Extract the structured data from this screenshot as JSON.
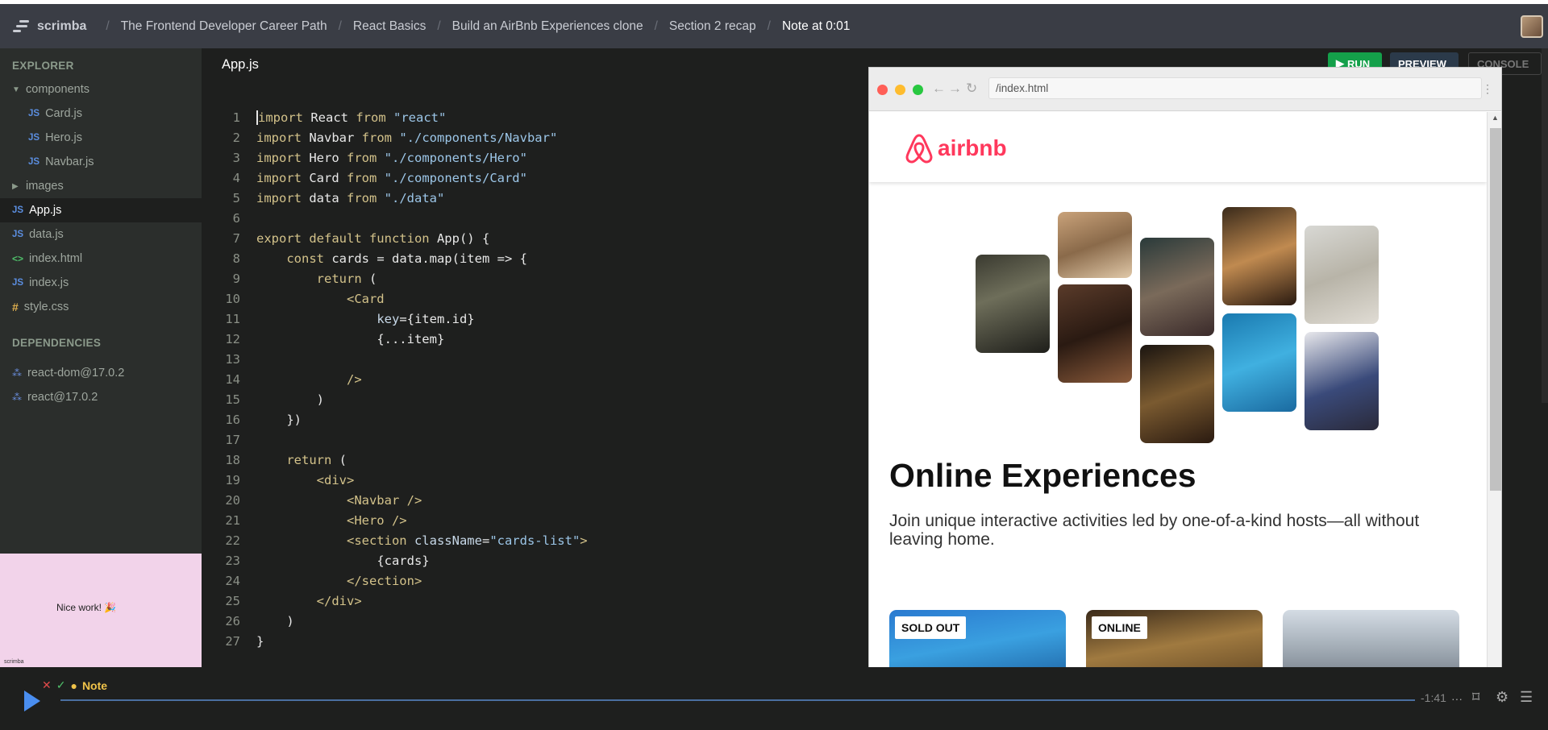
{
  "topbar": {
    "logo_text": "scrimba",
    "breadcrumbs": [
      "The Frontend Developer Career Path",
      "React Basics",
      "Build an AirBnb Experiences clone",
      "Section 2 recap",
      "Note at 0:01"
    ]
  },
  "sidebar": {
    "explorer_heading": "EXPLORER",
    "folder_components": "components",
    "card_js": "Card.js",
    "hero_js": "Hero.js",
    "navbar_js": "Navbar.js",
    "folder_images": "images",
    "app_js": "App.js",
    "data_js": "data.js",
    "index_html": "index.html",
    "index_js": "index.js",
    "style_css": "style.css",
    "dependencies_heading": "DEPENDENCIES",
    "dep_react_dom": "react-dom@17.0.2",
    "dep_react": "react@17.0.2",
    "icon_js": "JS",
    "icon_html": "<>",
    "icon_css": "#"
  },
  "nicework": {
    "text": "Nice work! 🎉",
    "small": "scrimba"
  },
  "editor": {
    "filename": "App.js",
    "lines": [
      "1",
      "2",
      "3",
      "4",
      "5",
      "6",
      "7",
      "8",
      "9",
      "10",
      "11",
      "12",
      "13",
      "14",
      "15",
      "16",
      "17",
      "18",
      "19",
      "20",
      "21",
      "22",
      "23",
      "24",
      "25",
      "26",
      "27"
    ],
    "t": {
      "import": "import",
      "from": "from",
      "react_mod": "\"react\"",
      "navbar_mod": "\"./components/Navbar\"",
      "hero_mod": "\"./components/Hero\"",
      "card_mod": "\"./components/Card\"",
      "data_mod": "\"./data\"",
      "React": " React ",
      "Navbar": " Navbar ",
      "Hero": " Hero ",
      "Card": " Card ",
      "data": " data ",
      "export_default_function": "export default function",
      "app_sig": " App() {",
      "const": "const",
      "cards_map": " cards = data.map(item => {",
      "return": "return",
      "paren_open": " (",
      "card_tag": "<Card",
      "key_attr": "key",
      "key_val": "={item.id}",
      "spread": "{...item}",
      "self_close": "/>",
      "paren_close": ")",
      "close_map": "})",
      "div_open": "<div>",
      "navbar_tag": "<Navbar />",
      "hero_tag": "<Hero />",
      "section_open": "<section",
      "classname_attr": " className",
      "eq": "=",
      "cards_list": "\"cards-list\"",
      "gt": ">",
      "cards_expr": "{cards}",
      "section_close": "</section>",
      "div_close": "</div>",
      "brace_close": "}"
    }
  },
  "buttons": {
    "run": "RUN",
    "preview": "PREVIEW",
    "console": "CONSOLE"
  },
  "browser": {
    "url": "/index.html",
    "brand": "airbnb",
    "title": "Online Experiences",
    "subtitle": "Join unique interactive activities led by one-of-a-kind hosts—all without leaving home.",
    "cards": [
      {
        "badge": "SOLD OUT"
      },
      {
        "badge": "ONLINE"
      },
      {
        "badge": ""
      }
    ]
  },
  "player": {
    "note": "Note",
    "time": "-1:41"
  }
}
